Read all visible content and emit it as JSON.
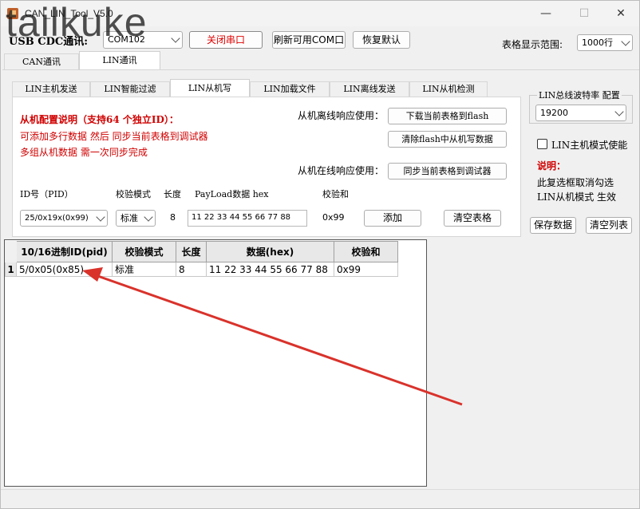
{
  "window": {
    "title": "CAN_LIN_Tool_V5.0",
    "watermark": "tailkuke",
    "minimize": "—",
    "maximize": "☐",
    "close": "✕"
  },
  "toolbar": {
    "usb_label": "USB CDC通讯:",
    "port_value": "COM102",
    "close_port": "关闭串口",
    "refresh_ports": "刷新可用COM口",
    "restore_default": "恢复默认",
    "range_label": "表格显示范围:",
    "range_value": "1000行"
  },
  "main_tabs": [
    "CAN通讯",
    "LIN通讯"
  ],
  "sub_tabs": [
    "LIN主机发送",
    "LIN智能过滤",
    "LIN从机写",
    "LIN加载文件",
    "LIN离线发送",
    "LIN从机检测"
  ],
  "config": {
    "heading": "从机配置说明（支持64 个独立ID）：",
    "line1": "可添加多行数据 然后 同步当前表格到调试器",
    "line2": "多组从机数据 需一次同步完成",
    "offline_label": "从机离线响应使用：",
    "online_label": "从机在线响应使用：",
    "download_flash": "下载当前表格到flash",
    "clear_flash": "清除flash中从机写数据",
    "sync_debugger": "同步当前表格到调试器"
  },
  "form": {
    "id_label": "ID号（PID）",
    "check_label": "校验模式",
    "len_label": "长度",
    "payload_label": "PayLoad数据 hex",
    "checksum_label": "校验和",
    "id_value": "25/0x19x(0x99)",
    "check_value": "标准",
    "len_value": "8",
    "payload_value": "11 22 33 44 55 66 77 88",
    "checksum_value": "0x99",
    "add": "添加",
    "clear_table": "清空表格"
  },
  "right_panel": {
    "baud_label": "LIN总线波特率 配置",
    "baud_value": "19200",
    "master_mode": "LIN主机模式使能",
    "note_title": "说明：",
    "note_line1": "此复选框取消勾选",
    "note_line2": "LIN从机模式 生效",
    "save_data": "保存数据",
    "clear_list": "清空列表"
  },
  "table": {
    "headers": [
      "10/16进制ID(pid)",
      "校验模式",
      "长度",
      "数据(hex)",
      "校验和"
    ],
    "rows": [
      {
        "num": "1",
        "id": "5/0x05(0x85)",
        "check": "标准",
        "len": "8",
        "data": "11 22 33 44 55 66 77 88",
        "sum": "0x99"
      }
    ]
  },
  "colors": {
    "arrow": "#d9322b",
    "red_text": "#d00000"
  }
}
